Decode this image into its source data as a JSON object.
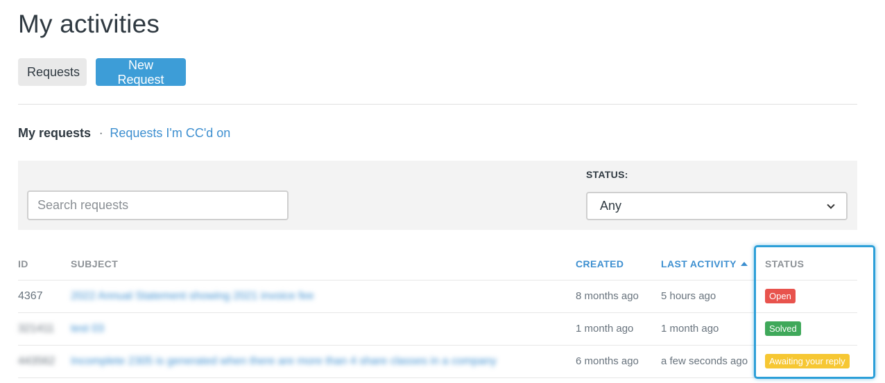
{
  "page": {
    "title": "My activities"
  },
  "actions": {
    "requests_label": "Requests",
    "new_request_label": "New Request"
  },
  "subnav": {
    "current": "My requests",
    "separator": "·",
    "cc_link": "Requests I'm CC'd on"
  },
  "filters": {
    "search_placeholder": "Search requests",
    "status_label": "STATUS:",
    "status_selected": "Any"
  },
  "table": {
    "headers": {
      "id": "ID",
      "subject": "SUBJECT",
      "created": "CREATED",
      "last_activity": "LAST ACTIVITY",
      "status": "STATUS"
    },
    "rows": [
      {
        "id": "4367",
        "subject": "2022 Annual Statement showing 2021 invoice fee",
        "created": "8 months ago",
        "last_activity": "5 hours ago",
        "status": "Open"
      },
      {
        "id": "321411",
        "subject": "test 03",
        "created": "1 month ago",
        "last_activity": "1 month ago",
        "status": "Solved"
      },
      {
        "id": "443562",
        "subject": "Incomplete 2305 is generated when there are more than 4 share classes in a company",
        "created": "6 months ago",
        "last_activity": "a few seconds ago",
        "status": "Awaiting your reply"
      }
    ]
  },
  "colors": {
    "accent": "#3d9dd7",
    "link": "#3d8fd0",
    "status_open": "#e8534d",
    "status_solved": "#3fa85a",
    "status_awaiting": "#f6c733",
    "highlight": "#2c9fd8"
  },
  "icons": {
    "select_chevron": "chevron-down-icon",
    "sort_indicator": "sort-ascending-icon"
  }
}
